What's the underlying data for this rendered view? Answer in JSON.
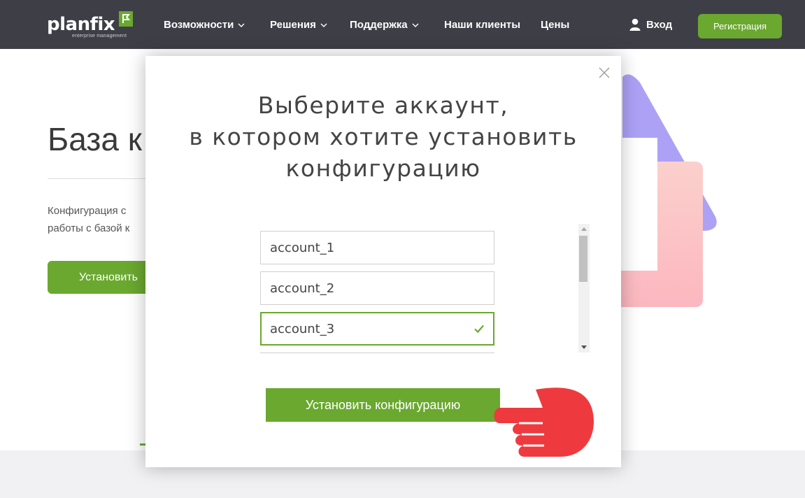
{
  "header": {
    "logo": {
      "name": "planfix",
      "tagline": "enterprise management"
    },
    "nav": [
      {
        "label": "Возможности",
        "dropdown": true
      },
      {
        "label": "Решения",
        "dropdown": true
      },
      {
        "label": "Поддержка",
        "dropdown": true
      },
      {
        "label": "Наши клиенты",
        "dropdown": false
      },
      {
        "label": "Цены",
        "dropdown": false
      }
    ],
    "login_label": "Вход",
    "register_label": "Регистрация"
  },
  "background_page": {
    "title": "База к",
    "description_line1": "Конфигурация с",
    "description_line2": "работы с базой к",
    "install_label": "Установить"
  },
  "modal": {
    "title_line1": "Выберите аккаунт,",
    "title_line2": "в котором хотите установить",
    "title_line3": "конфигурацию",
    "accounts": [
      {
        "name": "account_1",
        "selected": false
      },
      {
        "name": "account_2",
        "selected": false
      },
      {
        "name": "account_3",
        "selected": true
      }
    ],
    "install_button_label": "Установить конфигурацию"
  },
  "colors": {
    "header_bg": "#3e3f46",
    "brand_green": "#6aa82f",
    "pointer_red": "#ee3a3f"
  }
}
